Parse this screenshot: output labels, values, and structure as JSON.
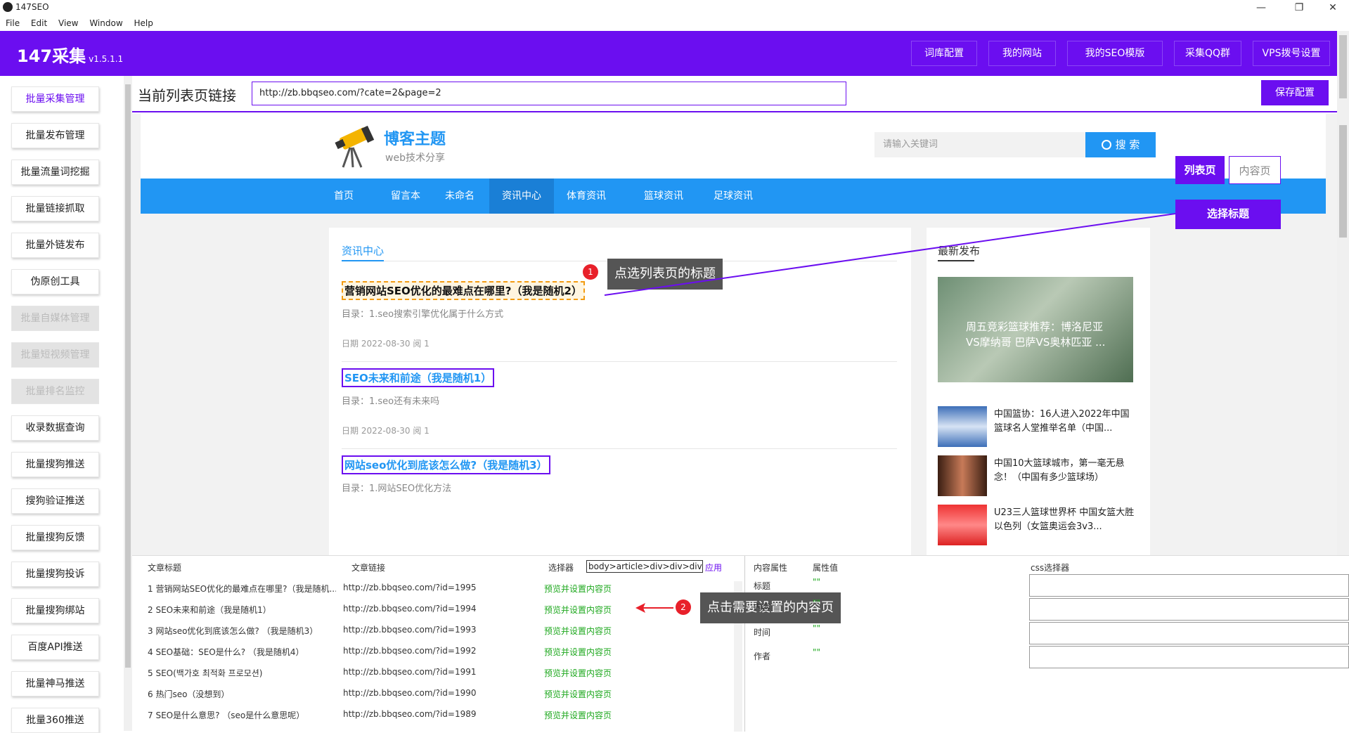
{
  "window": {
    "title": "147SEO",
    "controls": [
      "—",
      "❐",
      "✕"
    ]
  },
  "menu": [
    "File",
    "Edit",
    "View",
    "Window",
    "Help"
  ],
  "header": {
    "app_name": "147采集",
    "version": "v1.5.1.1",
    "buttons": [
      "词库配置",
      "我的网站",
      "我的SEO模版",
      "采集QQ群",
      "VPS拨号设置"
    ]
  },
  "sidebar": {
    "items": [
      {
        "label": "批量采集管理",
        "state": "active"
      },
      {
        "label": "批量发布管理",
        "state": "normal"
      },
      {
        "label": "批量流量词挖掘",
        "state": "normal"
      },
      {
        "label": "批量链接抓取",
        "state": "normal"
      },
      {
        "label": "批量外链发布",
        "state": "normal"
      },
      {
        "label": "伪原创工具",
        "state": "normal"
      },
      {
        "label": "批量自媒体管理",
        "state": "disabled"
      },
      {
        "label": "批量短视频管理",
        "state": "disabled"
      },
      {
        "label": "批量排名监控",
        "state": "disabled"
      },
      {
        "label": "收录数据查询",
        "state": "normal"
      },
      {
        "label": "批量搜狗推送",
        "state": "normal"
      },
      {
        "label": "搜狗验证推送",
        "state": "normal"
      },
      {
        "label": "批量搜狗反馈",
        "state": "normal"
      },
      {
        "label": "批量搜狗投诉",
        "state": "normal"
      },
      {
        "label": "批量搜狗绑站",
        "state": "normal"
      },
      {
        "label": "百度API推送",
        "state": "normal"
      },
      {
        "label": "批量神马推送",
        "state": "normal"
      },
      {
        "label": "批量360推送",
        "state": "normal"
      }
    ]
  },
  "url_row": {
    "label": "当前列表页链接",
    "value": "http://zb.bbqseo.com/?cate=2&page=2",
    "save_label": "保存配置"
  },
  "site": {
    "brand_title": "博客主题",
    "brand_subtitle": "web技术分享",
    "search_placeholder": "请输入关键词",
    "search_button": "搜 索",
    "nav": [
      "首页",
      "留言本",
      "未命名",
      "资讯中心",
      "体育资讯",
      "篮球资讯",
      "足球资讯"
    ],
    "nav_selected": "资讯中心",
    "section_title": "资讯中心",
    "articles": [
      {
        "title": "营销网站SEO优化的最难点在哪里?（我是随机2）",
        "desc": "目录：1.seo搜索引擎优化属于什么方式",
        "meta": "日期 2022-08-30  阅 1"
      },
      {
        "title": "SEO未来和前途（我是随机1）",
        "desc": "目录：1.seo还有未来吗",
        "meta": "日期 2022-08-30  阅 1"
      },
      {
        "title": "网站seo优化到底该怎么做?（我是随机3）",
        "desc": "目录：1.网站SEO优化方法",
        "meta": ""
      }
    ],
    "sidebar_title": "最新发布",
    "featured_caption": "周五竞彩篮球推荐：博洛尼亚VS摩纳哥 巴萨VS奥林匹亚 ...",
    "side_posts": [
      "中国篮协：16人进入2022年中国篮球名人堂推举名单（中国...",
      "中国10大篮球城市，第一毫无悬念！（中国有多少篮球场）",
      "U23三人篮球世界杯 中国女篮大胜以色列（女篮奥运会3v3..."
    ]
  },
  "overlay": {
    "list_page": "列表页",
    "content_page": "内容页",
    "select_title": "选择标题"
  },
  "callouts": {
    "one": {
      "num": "1",
      "text": "点选列表页的标题"
    },
    "two": {
      "num": "2",
      "text": "点击需要设置的内容页"
    }
  },
  "bottom": {
    "headers": {
      "title": "文章标题",
      "link": "文章链接",
      "selector": "选择器",
      "apply": "应用"
    },
    "selector_value": "body>article>div>div>div>ul",
    "rows": [
      {
        "title": "1 营销网站SEO优化的最难点在哪里?（我是随机...",
        "link": "http://zb.bbqseo.com/?id=1995",
        "action": "预览并设置内容页"
      },
      {
        "title": "2 SEO未来和前途（我是随机1）",
        "link": "http://zb.bbqseo.com/?id=1994",
        "action": "预览并设置内容页"
      },
      {
        "title": "3 网站seo优化到底该怎么做? （我是随机3）",
        "link": "http://zb.bbqseo.com/?id=1993",
        "action": "预览并设置内容页"
      },
      {
        "title": "4 SEO基础：SEO是什么? （我是随机4）",
        "link": "http://zb.bbqseo.com/?id=1992",
        "action": "预览并设置内容页"
      },
      {
        "title": "5 SEO(백가호 최적화 프로모션)",
        "link": "http://zb.bbqseo.com/?id=1991",
        "action": "预览并设置内容页"
      },
      {
        "title": "6 热门seo（没想到）",
        "link": "http://zb.bbqseo.com/?id=1990",
        "action": "预览并设置内容页"
      },
      {
        "title": "7 SEO是什么意思? （seo是什么意思呢）",
        "link": "http://zb.bbqseo.com/?id=1989",
        "action": "预览并设置内容页"
      }
    ],
    "attr_headers": {
      "prop": "内容属性",
      "value": "属性值",
      "css": "css选择器"
    },
    "attrs": [
      {
        "prop": "标题",
        "value": "\"\""
      },
      {
        "prop": "内容",
        "value": "\"\""
      },
      {
        "prop": "时间",
        "value": "\"\""
      },
      {
        "prop": "作者",
        "value": "\"\""
      }
    ]
  },
  "colors": {
    "brand_purple": "#6b0ef0",
    "site_blue": "#2196f3",
    "callout_red": "#e8202a",
    "link_green": "#1ea81e"
  }
}
